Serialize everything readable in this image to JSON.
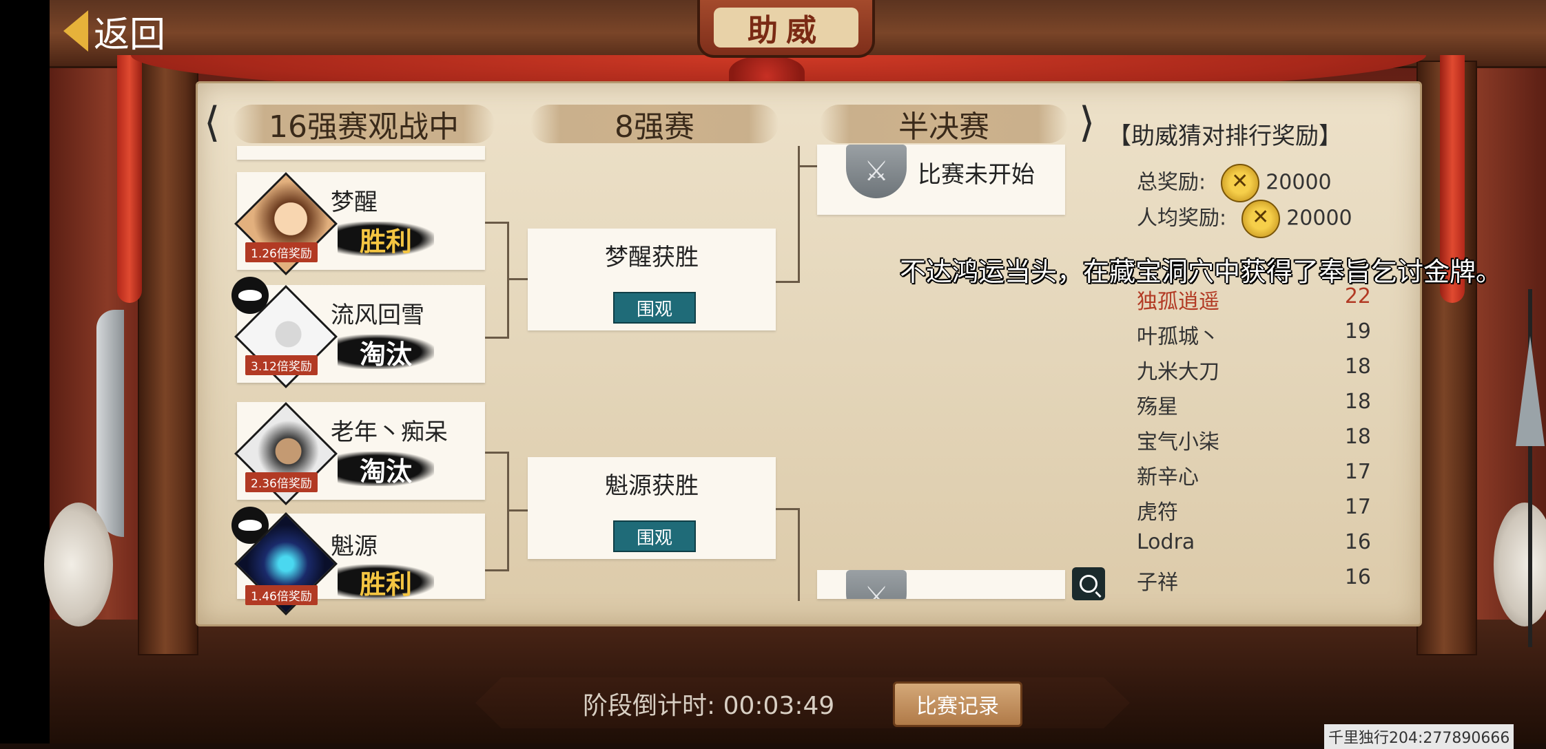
{
  "top": {
    "back_label": "返回",
    "title": "助威"
  },
  "rounds": {
    "r16": "16强赛观战中",
    "r8": "8强赛",
    "semi": "半决赛"
  },
  "players": [
    {
      "name": "梦醒",
      "badge": "1.26倍奖励",
      "result": "胜利",
      "status": "win"
    },
    {
      "name": "流风回雪",
      "badge": "3.12倍奖励",
      "result": "淘汰",
      "status": "lose"
    },
    {
      "name": "老年丶痴呆",
      "badge": "2.36倍奖励",
      "result": "淘汰",
      "status": "lose"
    },
    {
      "name": "魁源",
      "badge": "1.46倍奖励",
      "result": "胜利",
      "status": "win"
    }
  ],
  "quarter": [
    {
      "title": "梦醒获胜",
      "button": "围观"
    },
    {
      "title": "魁源获胜",
      "button": "围观"
    }
  ],
  "semi": {
    "status": "比赛未开始"
  },
  "leaderboard": {
    "title": "【助威猜对排行奖励】",
    "total_label": "总奖励:",
    "total_value": "20000",
    "per_label": "人均奖励:",
    "per_value": "20000",
    "rows": [
      {
        "name": "独孤逍遥",
        "score": "22"
      },
      {
        "name": "叶孤城丶",
        "score": "19"
      },
      {
        "name": "九米大刀",
        "score": "18"
      },
      {
        "name": "殇星",
        "score": "18"
      },
      {
        "name": "宝气小柒",
        "score": "18"
      },
      {
        "name": "新辛心",
        "score": "17"
      },
      {
        "name": "虎符",
        "score": "17"
      },
      {
        "name": "Lodra",
        "score": "16"
      },
      {
        "name": "子祥",
        "score": "16"
      }
    ]
  },
  "overlay_message": "不达鸿运当头，在藏宝洞穴中获得了奉旨乞讨金牌。",
  "bottom": {
    "countdown_label": "阶段倒计时:",
    "countdown_value": "00:03:49",
    "record_button": "比赛记录"
  },
  "footer": "千里独行204:277890666",
  "colors": {
    "accent_teal": "#1f6b78",
    "winner_gold": "#f4c542",
    "top_rank_red": "#b23a24"
  }
}
